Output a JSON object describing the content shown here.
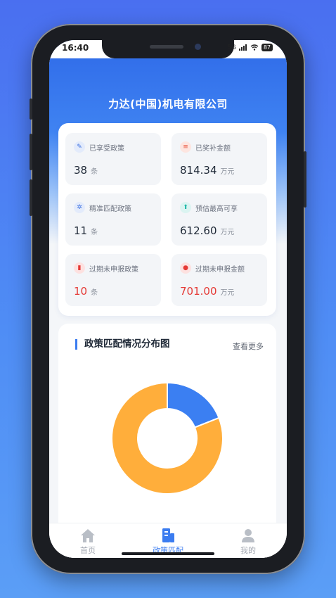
{
  "status_bar": {
    "time": "16:40",
    "network": "5G",
    "battery": "87"
  },
  "company_name": "力达(中国)机电有限公司",
  "stats": [
    {
      "label": "已享受政策",
      "value": "38",
      "unit": "条",
      "icon": "edit-icon",
      "icon_color": "#3b6fe0",
      "icon_bg": "#e3ebfb",
      "value_color": "#1f2937"
    },
    {
      "label": "已奖补金额",
      "value": "814.34",
      "unit": "万元",
      "icon": "coin-stack-icon",
      "icon_color": "#e8533c",
      "icon_bg": "#fde5e0",
      "value_color": "#1f2937"
    },
    {
      "label": "精准匹配政策",
      "value": "11",
      "unit": "条",
      "icon": "target-icon",
      "icon_color": "#3b6fe0",
      "icon_bg": "#e3ebfb",
      "value_color": "#1f2937"
    },
    {
      "label": "预估最高可享",
      "value": "612.60",
      "unit": "万元",
      "icon": "arrow-up-icon",
      "icon_color": "#1fb7a8",
      "icon_bg": "#dbf4f1",
      "value_color": "#1f2937"
    },
    {
      "label": "过期未申报政策",
      "value": "10",
      "unit": "条",
      "icon": "document-icon",
      "icon_color": "#e53935",
      "icon_bg": "#fde1e0",
      "value_color": "#e53935"
    },
    {
      "label": "过期未申报金额",
      "value": "701.00",
      "unit": "万元",
      "icon": "money-icon",
      "icon_color": "#e53935",
      "icon_bg": "#fde1e0",
      "value_color": "#e53935"
    }
  ],
  "chart_section": {
    "title": "政策匹配情况分布图",
    "more_link": "查看更多"
  },
  "chart_data": {
    "type": "pie",
    "style": "donut",
    "series": [
      {
        "value": 0.19,
        "color": "#3b7ff2"
      },
      {
        "value": 0.81,
        "color": "#ffae3b"
      }
    ]
  },
  "tabs": [
    {
      "label": "首页",
      "icon": "home-icon",
      "active": false
    },
    {
      "label": "政策匹配",
      "icon": "building-icon",
      "active": true
    },
    {
      "label": "我的",
      "icon": "user-icon",
      "active": false
    }
  ],
  "colors": {
    "accent": "#3b7cf0",
    "alert": "#e53935",
    "inactive": "#a4a9b3"
  }
}
